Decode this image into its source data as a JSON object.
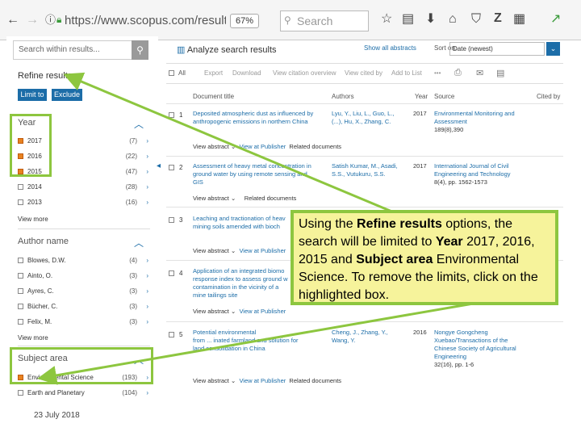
{
  "browser": {
    "url": "https://www.scopus.com/results/r",
    "zoom": "67%",
    "search_placeholder": "Search",
    "icons": [
      "back-icon",
      "forward-icon",
      "info-icon",
      "lock-icon",
      "star-icon",
      "reader-icon",
      "download-icon",
      "home-icon",
      "pocket-icon",
      "zotero-icon",
      "menu-icon",
      "extension-icon"
    ]
  },
  "sidebar": {
    "search_placeholder": "Search within results...",
    "refine_title": "Refine results",
    "limit_label": "Limit to",
    "exclude_label": "Exclude",
    "year": {
      "title": "Year",
      "items": [
        {
          "label": "2017",
          "count": "(7)",
          "checked": true
        },
        {
          "label": "2016",
          "count": "(22)",
          "checked": true
        },
        {
          "label": "2015",
          "count": "(47)",
          "checked": true
        },
        {
          "label": "2014",
          "count": "(28)",
          "checked": false
        },
        {
          "label": "2013",
          "count": "(16)",
          "checked": false
        }
      ],
      "view_more": "View more"
    },
    "author": {
      "title": "Author name",
      "items": [
        {
          "label": "Blowes, D.W.",
          "count": "(4)"
        },
        {
          "label": "Ainto, O.",
          "count": "(3)"
        },
        {
          "label": "Ayres, C.",
          "count": "(3)"
        },
        {
          "label": "Bücher, C.",
          "count": "(3)"
        },
        {
          "label": "Felix, M.",
          "count": "(3)"
        }
      ],
      "view_more": "View more"
    },
    "subject": {
      "title": "Subject area",
      "items": [
        {
          "label": "Environmental Science",
          "count": "(193)",
          "checked": true
        },
        {
          "label": "Earth and Planetary",
          "count": "(104)",
          "checked": false
        }
      ]
    }
  },
  "results": {
    "analyze": "Analyze search results",
    "show_all_abstracts": "Show all abstracts",
    "sort_on": "Sort on:",
    "sort_value": "Date (newest)",
    "toolbar": {
      "all": "All",
      "export": "Export",
      "download": "Download",
      "citation": "View citation overview",
      "cited_by": "View cited by",
      "add_list": "Add to List"
    },
    "columns": {
      "title": "Document title",
      "authors": "Authors",
      "year": "Year",
      "source": "Source",
      "cited": "Cited by"
    },
    "rows": [
      {
        "num": "1",
        "title_1": "Deposited atmospheric dust as influenced by",
        "title_2": "anthropogenic emissions in northern China",
        "title_3": "",
        "authors_1": "Lyu, Y., Liu, L., Guo, L.,",
        "authors_2": "(...), Hu, X., Zhang, C.",
        "year": "2017",
        "source_1": "Environmental Monitoring and",
        "source_2": "Assessment",
        "source_3": "189(8),390",
        "source_4": ""
      },
      {
        "num": "2",
        "title_1": "Assessment of heavy metal concentration in",
        "title_2": "ground water by using remote sensing and",
        "title_3": "GIS",
        "authors_1": "Satish Kumar, M., Asadi,",
        "authors_2": "S.S., Vutukuru, S.S.",
        "year": "2017",
        "source_1": "International Journal of Civil",
        "source_2": "Engineering and Technology",
        "source_3": "8(4), pp. 1562-1573",
        "source_4": ""
      },
      {
        "num": "3",
        "title_1": "Leaching and tractionation of heav",
        "title_2": "mining soils amended with bioch",
        "title_3": ""
      },
      {
        "num": "4",
        "title_1": "Application of an integrated biomo",
        "title_2": "response index to assess ground w",
        "title_3": "contamination in the vicinity of a",
        "title_4": "mine tailings site"
      },
      {
        "num": "5",
        "title_1": "Potential environmental",
        "title_2": "from ... inated farmland and solution for",
        "title_3": "land consolidation in China",
        "authors_1": "Cheng, J., Zhang, Y.,",
        "authors_2": "Wang, Y.",
        "year": "2016",
        "source_1": "Nongye Gongcheng",
        "source_2": "Xuebao/Transactions of the",
        "source_3": "Chinese Society of Agricultural",
        "source_4": "Engineering",
        "source_5": "32(16), pp. 1-6"
      }
    ],
    "view_abstract": "View abstract",
    "view_publisher": "View at Publisher",
    "related": "Related documents"
  },
  "callout": {
    "t1": "Using the ",
    "b1": "Refine results",
    "t2": " options, the search will be limited to ",
    "b2": "Year",
    "t3": " 2017, 2016, 2015 and ",
    "b3": "Subject area",
    "t4": " Environmental Science.  To remove the limits, click on the highlighted box."
  },
  "footer": "23 July 2018",
  "colors": {
    "highlight": "#8dc63f",
    "callout_bg": "#f6f39b",
    "scopus_blue": "#1c6da8",
    "checked": "#e8821f"
  }
}
